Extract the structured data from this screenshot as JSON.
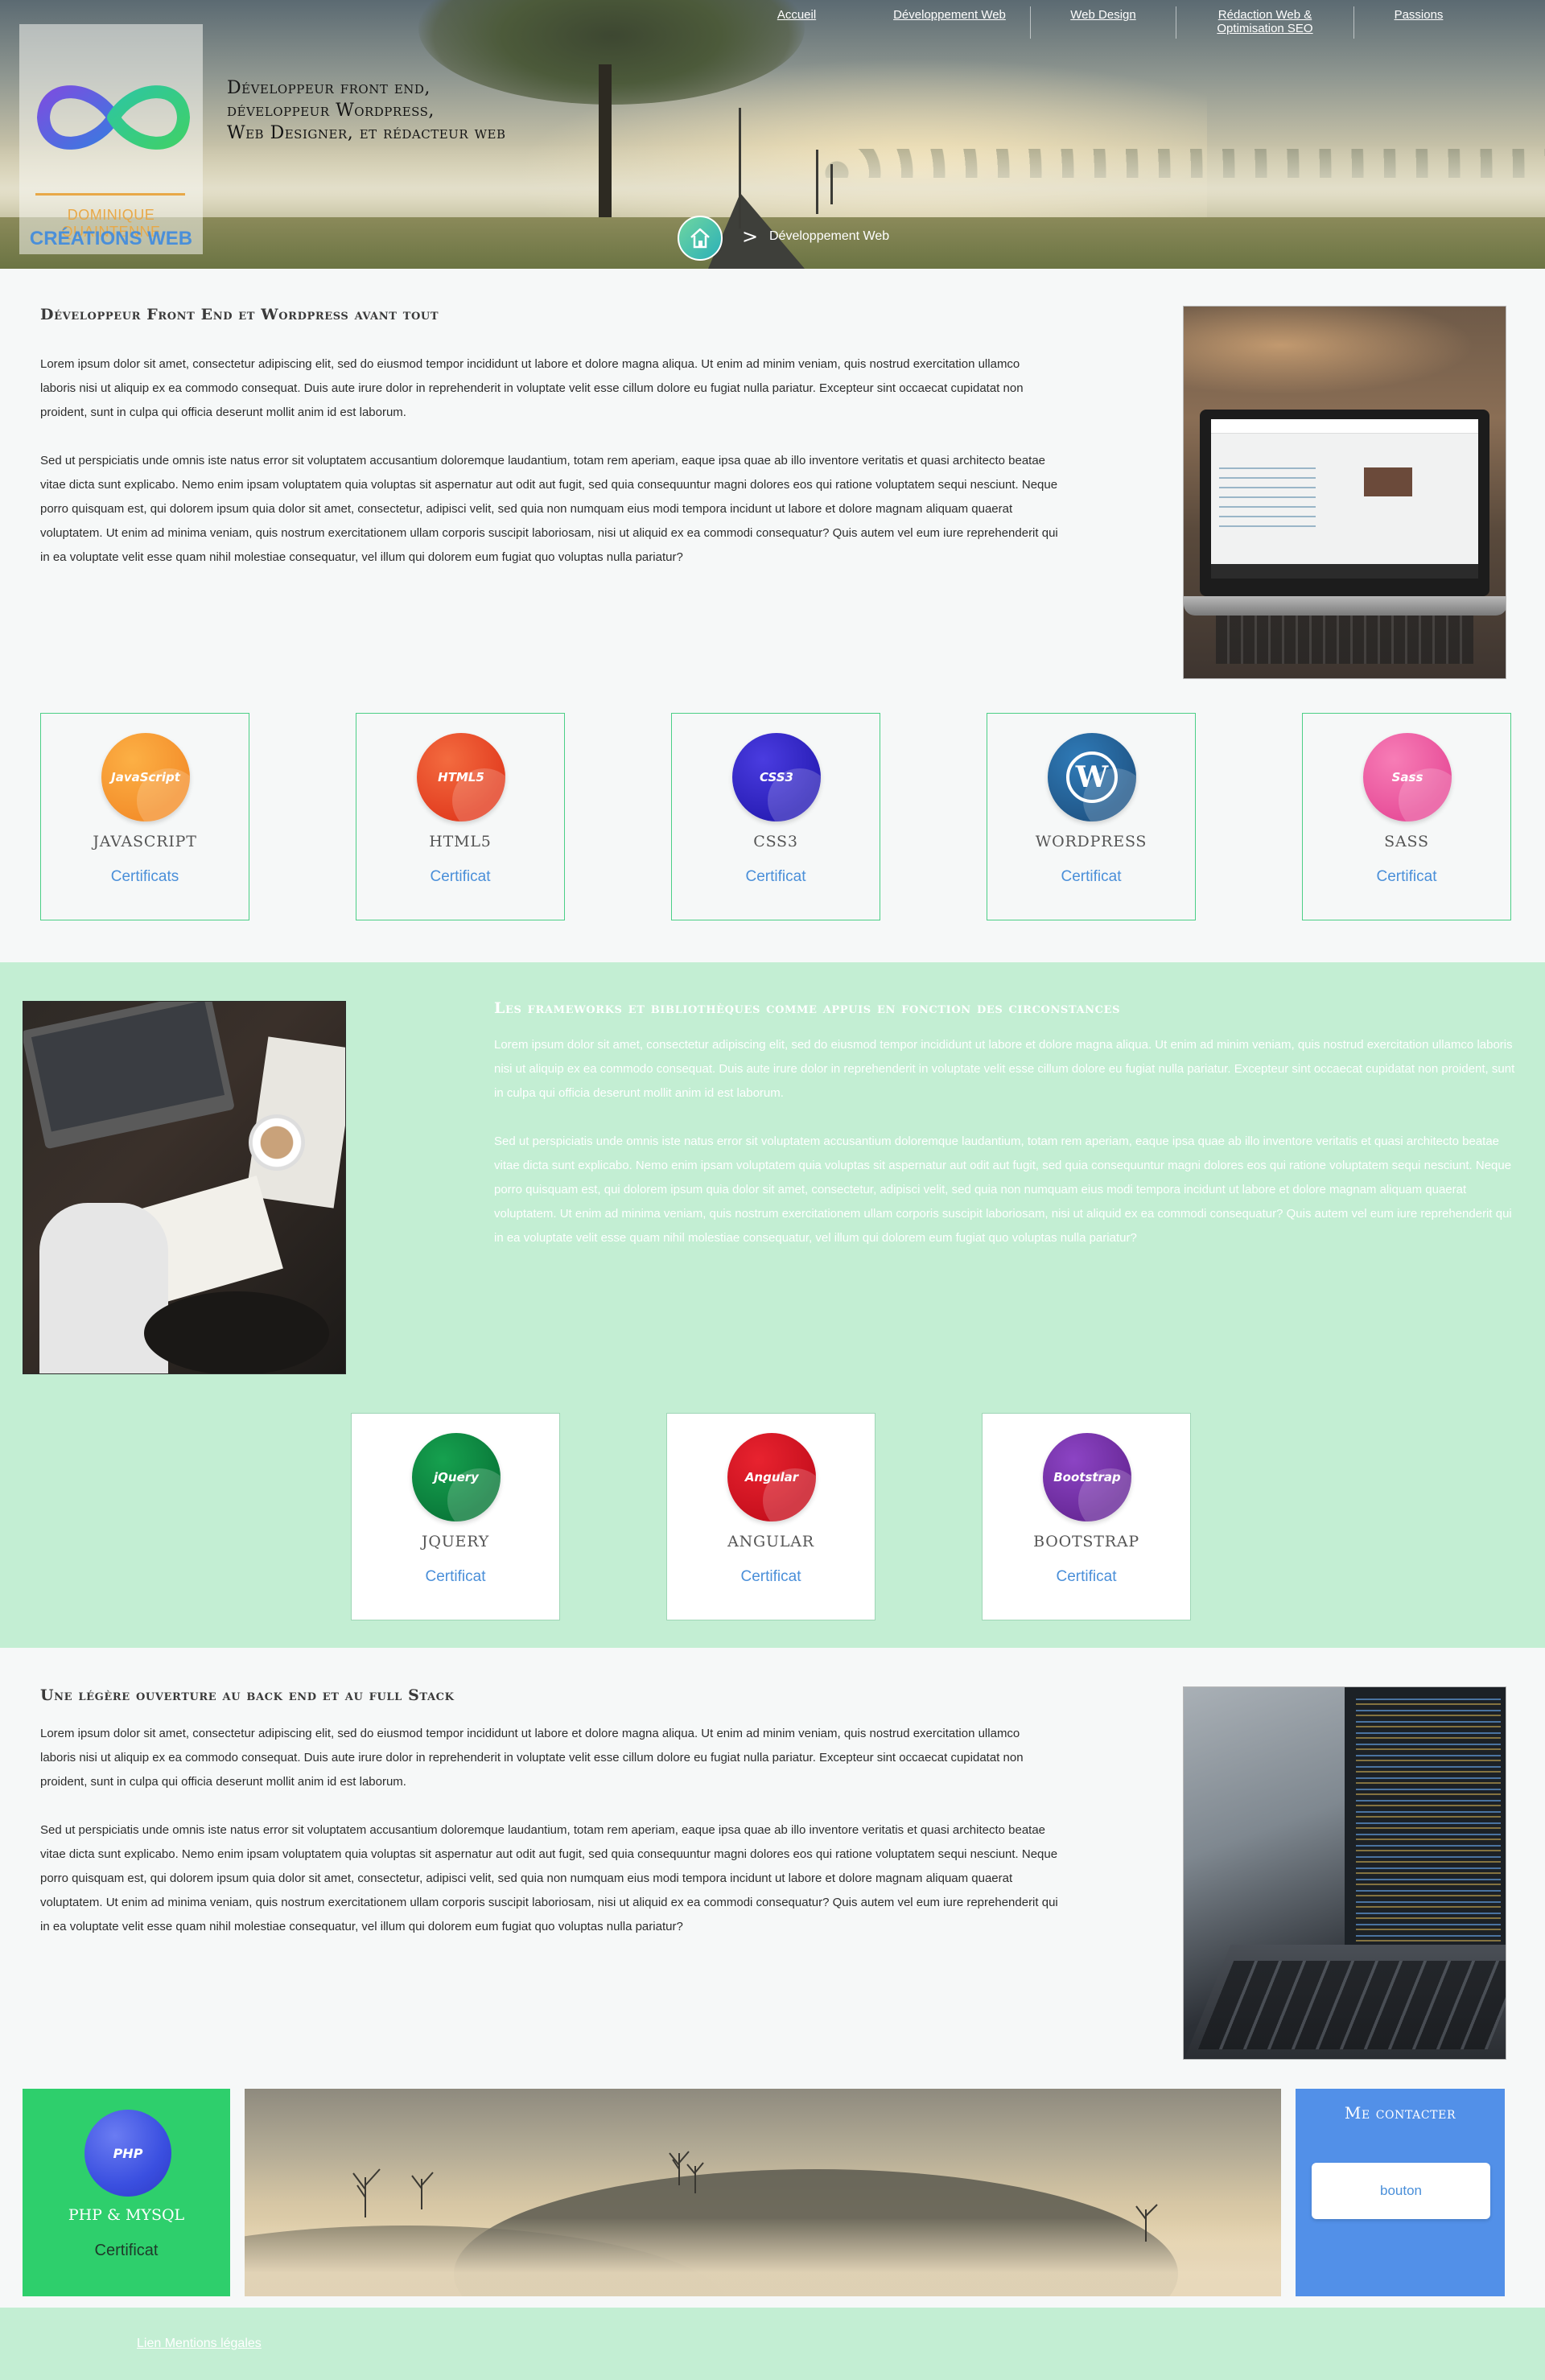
{
  "nav": {
    "items": [
      {
        "label": "Accueil"
      },
      {
        "label": "Développement Web"
      },
      {
        "label": "Web Design"
      },
      {
        "label": "Rédaction Web & Optimisation SEO"
      },
      {
        "label": "Passions"
      }
    ]
  },
  "brand": {
    "name": "DOMINIQUE QUAINTENNE",
    "subtitle": "CRÉATIONS WEB",
    "tagline_1": "Développeur front end,",
    "tagline_2": "développeur Wordpress,",
    "tagline_3": "Web Designer, et rédacteur web"
  },
  "breadcrumb": {
    "separator": ">",
    "current": "Développement Web"
  },
  "section1": {
    "title": "Développeur Front End et Wordpress avant tout",
    "p1": "Lorem ipsum dolor sit amet, consectetur adipiscing elit, sed do eiusmod tempor incididunt ut labore et dolore magna aliqua. Ut enim ad minim veniam, quis nostrud exercitation ullamco laboris nisi ut aliquip ex ea commodo consequat. Duis aute irure dolor in reprehenderit in voluptate velit esse cillum dolore eu fugiat nulla pariatur. Excepteur sint occaecat cupidatat non proident, sunt in culpa qui officia deserunt mollit anim id est laborum.",
    "p2": "Sed ut perspiciatis unde omnis iste natus error sit voluptatem accusantium doloremque laudantium, totam rem aperiam, eaque ipsa quae ab illo inventore veritatis et quasi architecto beatae vitae dicta sunt explicabo. Nemo enim ipsam voluptatem quia voluptas sit aspernatur aut odit aut fugit, sed quia consequuntur magni dolores eos qui ratione voluptatem sequi nesciunt. Neque porro quisquam est, qui dolorem ipsum quia dolor sit amet, consectetur, adipisci velit, sed quia non numquam eius modi tempora incidunt ut labore et dolore magnam aliquam quaerat voluptatem. Ut enim ad minima veniam, quis nostrum exercitationem ullam corporis suscipit laboriosam, nisi ut aliquid ex ea commodi consequatur? Quis autem vel eum iure reprehenderit qui in ea voluptate velit esse quam nihil molestiae consequatur, vel illum qui dolorem eum fugiat quo voluptas nulla pariatur?"
  },
  "skills_row1": [
    {
      "logo": "JavaScript",
      "name": "JAVASCRIPT",
      "cert": "Certificats",
      "color": "#f4902c",
      "color2": "#fcb045"
    },
    {
      "logo": "HTML5",
      "name": "HTML5",
      "cert": "Certificat",
      "color": "#e33f21",
      "color2": "#f36b3f"
    },
    {
      "logo": "CSS3",
      "name": "CSS3",
      "cert": "Certificat",
      "color": "#2a1fb8",
      "color2": "#4a3ce0"
    },
    {
      "logo": "W",
      "name": "WORDPRESS",
      "cert": "Certificat",
      "color": "#21588a",
      "color2": "#2f7bb8"
    },
    {
      "logo": "Sass",
      "name": "SASS",
      "cert": "Certificat",
      "color": "#e8509a",
      "color2": "#f77db6"
    }
  ],
  "section2": {
    "title": "Les frameworks et bibliothèques comme appuis en fonction des circonstances",
    "p1": "Lorem ipsum dolor sit amet, consectetur adipiscing elit, sed do eiusmod tempor incididunt ut labore et dolore magna aliqua. Ut enim ad minim veniam, quis nostrud exercitation ullamco laboris nisi ut aliquip ex ea commodo consequat. Duis aute irure dolor in reprehenderit in voluptate velit esse cillum dolore eu fugiat nulla pariatur. Excepteur sint occaecat cupidatat non proident, sunt in culpa qui officia deserunt mollit anim id est laborum.",
    "p2": "Sed ut perspiciatis unde omnis iste natus error sit voluptatem accusantium doloremque laudantium, totam rem aperiam, eaque ipsa quae ab illo inventore veritatis et quasi architecto beatae vitae dicta sunt explicabo. Nemo enim ipsam voluptatem quia voluptas sit aspernatur aut odit aut fugit, sed quia consequuntur magni dolores eos qui ratione voluptatem sequi nesciunt. Neque porro quisquam est, qui dolorem ipsum quia dolor sit amet, consectetur, adipisci velit, sed quia non numquam eius modi tempora incidunt ut labore et dolore magnam aliquam quaerat voluptatem. Ut enim ad minima veniam, quis nostrum exercitationem ullam corporis suscipit laboriosam, nisi ut aliquid ex ea commodi consequatur? Quis autem vel eum iure reprehenderit qui in ea voluptate velit esse quam nihil molestiae consequatur, vel illum qui dolorem eum fugiat quo voluptas nulla pariatur?"
  },
  "skills_row2": [
    {
      "logo": "jQuery",
      "name": "JQUERY",
      "cert": "Certificat",
      "color": "#0a7a3a",
      "color2": "#16a14f"
    },
    {
      "logo": "Angular",
      "name": "ANGULAR",
      "cert": "Certificat",
      "color": "#c8101e",
      "color2": "#e8232f"
    },
    {
      "logo": "Bootstrap",
      "name": "BOOTSTRAP",
      "cert": "Certificat",
      "color": "#6a2a9a",
      "color2": "#8c44c4"
    }
  ],
  "section3": {
    "title": "Une légère ouverture au back end et au full Stack",
    "p1": "Lorem ipsum dolor sit amet, consectetur adipiscing elit, sed do eiusmod tempor incididunt ut labore et dolore magna aliqua. Ut enim ad minim veniam, quis nostrud exercitation ullamco laboris nisi ut aliquip ex ea commodo consequat. Duis aute irure dolor in reprehenderit in voluptate velit esse cillum dolore eu fugiat nulla pariatur. Excepteur sint occaecat cupidatat non proident, sunt in culpa qui officia deserunt mollit anim id est laborum.",
    "p2": "Sed ut perspiciatis unde omnis iste natus error sit voluptatem accusantium doloremque laudantium, totam rem aperiam, eaque ipsa quae ab illo inventore veritatis et quasi architecto beatae vitae dicta sunt explicabo. Nemo enim ipsam voluptatem quia voluptas sit aspernatur aut odit aut fugit, sed quia consequuntur magni dolores eos qui ratione voluptatem sequi nesciunt. Neque porro quisquam est, qui dolorem ipsum quia dolor sit amet, consectetur, adipisci velit, sed quia non numquam eius modi tempora incidunt ut labore et dolore magnam aliquam quaerat voluptatem. Ut enim ad minima veniam, quis nostrum exercitationem ullam corporis suscipit laboriosam, nisi ut aliquid ex ea commodi consequatur? Quis autem vel eum iure reprehenderit qui in ea voluptate velit esse quam nihil molestiae consequatur, vel illum qui dolorem eum fugiat quo voluptas nulla pariatur?"
  },
  "php": {
    "logo": "PHP",
    "name": "PHP & MYSQL",
    "cert": "Certificat"
  },
  "contact": {
    "title": "Me contacter",
    "button": "bouton"
  },
  "footer": {
    "link": "Lien Mentions légales"
  },
  "colors": {
    "accent_green": "#2ecf6c",
    "light_green": "#c3eed3",
    "accent_blue": "#5290e8",
    "link_blue": "#4a8fd9",
    "logo_orange": "#e8a847"
  }
}
